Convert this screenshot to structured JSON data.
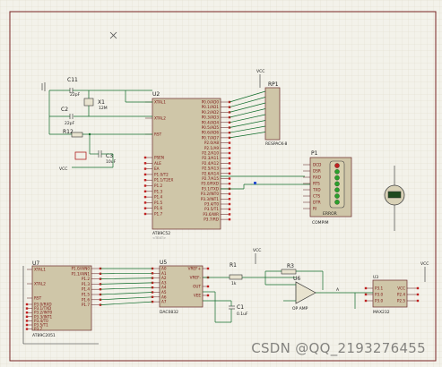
{
  "components": {
    "u2": {
      "ref": "U2",
      "part": "AT89C52",
      "left_pins": [
        "XTAL1",
        "XTAL2",
        "RST",
        "PSEN",
        "ALE",
        "EA",
        "P1.0/T2",
        "P1.1/T2EX",
        "P1.2",
        "P1.3",
        "P1.4",
        "P1.5",
        "P1.6",
        "P1.7"
      ],
      "right_pins": [
        "P0.0/AD0",
        "P0.1/AD1",
        "P0.2/AD2",
        "P0.3/AD3",
        "P0.4/AD4",
        "P0.5/AD5",
        "P0.6/AD6",
        "P0.7/AD7",
        "P2.0/A8",
        "P2.1/A9",
        "P2.2/A10",
        "P2.3/A11",
        "P2.4/A12",
        "P2.5/A13",
        "P2.6/A14",
        "P2.7/A15",
        "P3.0/RXD",
        "P3.1/TXD",
        "P3.2/INT0",
        "P3.3/INT1",
        "P3.4/T0",
        "P3.5/T1",
        "P3.6/WR",
        "P3.7/RD"
      ]
    },
    "u7": {
      "ref": "U7",
      "part": "AT89C2051",
      "left_pins": [
        "XTAL1",
        "XTAL2",
        "RST",
        "P3.0/RXD",
        "P3.1/TXD",
        "P3.2/INT0",
        "P3.3/INT1",
        "P3.4/T0",
        "P3.5/T1",
        "P3.7"
      ],
      "right_pins": [
        "P1.0/AIN0",
        "P1.1/AIN1",
        "P1.2",
        "P1.3",
        "P1.4",
        "P1.5",
        "P1.6",
        "P1.7"
      ]
    },
    "u5": {
      "ref": "U5",
      "part": "DAC0832",
      "left_pins": [
        "A0",
        "A1",
        "A2",
        "A3",
        "A4",
        "A5",
        "A6",
        "A7"
      ],
      "right_pins": [
        "VREF+",
        "VREF-",
        "OUT",
        "VEE"
      ]
    },
    "u3": {
      "ref": "U3",
      "part": "MAX232",
      "left_pins": [
        "P3.1",
        "P3.0",
        "P3.0"
      ],
      "right_pins": [
        "VCC",
        "P2.4",
        "P2.5"
      ]
    },
    "u6": {
      "ref": "U6",
      "part": "OP AMP"
    },
    "rp1": {
      "ref": "RP1",
      "part": "RESPACK-8"
    },
    "p1": {
      "ref": "P1",
      "part": "COMPIM",
      "pins": [
        "DCD",
        "DSR",
        "RXD",
        "RTS",
        "TXD",
        "CTS",
        "DTR",
        "RI"
      ],
      "label": "ERROR"
    },
    "c11": {
      "ref": "C11",
      "value": "22pF"
    },
    "c2": {
      "ref": "C2",
      "value": "22pF"
    },
    "x1": {
      "ref": "X1",
      "value": "12M"
    },
    "r12": {
      "ref": "R12",
      "value": "1k"
    },
    "c3": {
      "ref": "C3",
      "value": "10uF"
    },
    "r1": {
      "ref": "R1",
      "value": "1k"
    },
    "r3": {
      "ref": "R3",
      "value": "1k"
    },
    "c1": {
      "ref": "C1",
      "value": "0.1uF"
    },
    "vcc": "VCC",
    "text_tag": "<TEXT>",
    "net_a": "A"
  },
  "watermark": "CSDN @QQ_2193276455"
}
